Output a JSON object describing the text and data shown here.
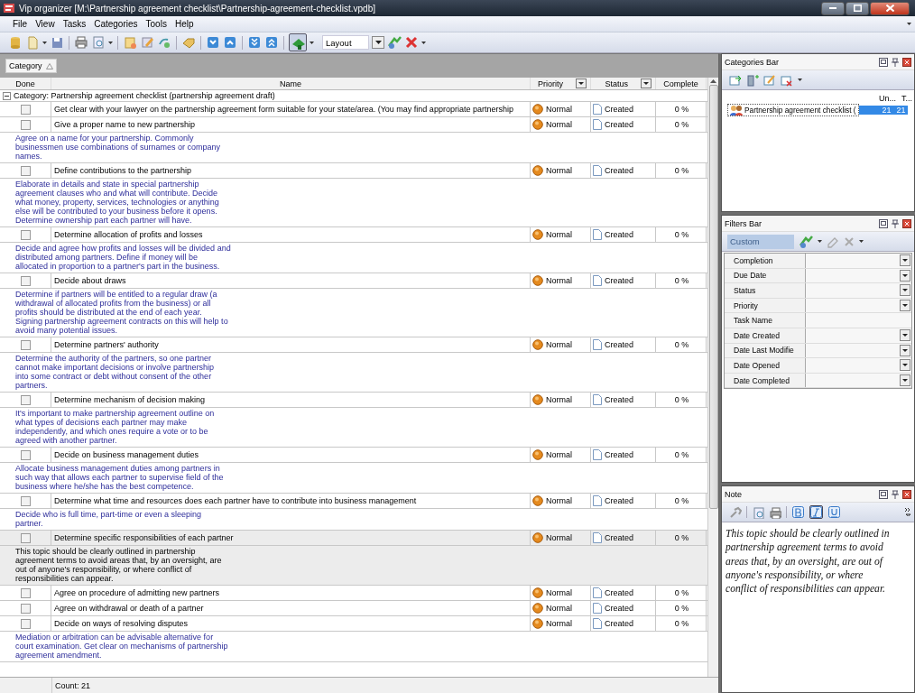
{
  "window": {
    "title": "Vip organizer [M:\\Partnership agreement checklist\\Partnership-agreement-checklist.vpdb]"
  },
  "menu": [
    {
      "label": "File"
    },
    {
      "label": "View"
    },
    {
      "label": "Tasks"
    },
    {
      "label": "Categories"
    },
    {
      "label": "Tools"
    },
    {
      "label": "Help"
    }
  ],
  "toolbar": {
    "layout_field": "Layout"
  },
  "grid": {
    "group_by": "Category",
    "columns": [
      "Done",
      "Name",
      "Priority",
      "Status",
      "Complete"
    ],
    "group": {
      "label": "Category: Partnership agreement checklist (partnership agreement draft)",
      "expanded": true
    },
    "tasks": [
      {
        "name": "Get clear with your lawyer on the partnership agreement form suitable for your state/area. (You may find appropriate partnership",
        "done": false,
        "priority": "Normal",
        "status": "Created",
        "complete": "0 %",
        "selected": false
      },
      {
        "name": "Give a proper name to new partnership",
        "done": false,
        "priority": "Normal",
        "status": "Created",
        "complete": "0 %",
        "selected": false,
        "note": "Agree on a name for your partnership. Commonly\nbusinessmen use combinations of surnames or company\nnames."
      },
      {
        "name": "Define contributions to the partnership",
        "done": false,
        "priority": "Normal",
        "status": "Created",
        "complete": "0 %",
        "selected": false,
        "note": "Elaborate in details and state in special partnership\nagreement clauses who and what will contribute. Decide\nwhat money, property, services, technologies or anything\nelse will be contributed to your business before it opens.\nDetermine ownership part each partner will have."
      },
      {
        "name": "Determine allocation of profits and losses",
        "done": false,
        "priority": "Normal",
        "status": "Created",
        "complete": "0 %",
        "selected": false,
        "note": "Decide and agree how profits and losses will be divided and\ndistributed among partners. Define if money will be\nallocated in proportion to a partner's part in the business."
      },
      {
        "name": "Decide about draws",
        "done": false,
        "priority": "Normal",
        "status": "Created",
        "complete": "0 %",
        "selected": false,
        "note": "Determine if partners will be entitled to a regular draw (a\nwithdrawal of allocated profits from the business) or all\nprofits should be distributed at the end of each year.\nSigning partnership agreement contracts on this will help to\navoid many potential issues."
      },
      {
        "name": "Determine partners' authority",
        "done": false,
        "priority": "Normal",
        "status": "Created",
        "complete": "0 %",
        "selected": false,
        "note": "Determine the authority of the partners, so one partner\ncannot make important decisions or involve partnership\ninto some contract or debt without consent of the other\npartners."
      },
      {
        "name": "Determine mechanism of decision making",
        "done": false,
        "priority": "Normal",
        "status": "Created",
        "complete": "0 %",
        "selected": false,
        "note": "It's important to make partnership agreement outline on\nwhat types of decisions each partner may make\nindependently, and which ones require a vote or to be\nagreed with another partner."
      },
      {
        "name": "Decide on business management duties",
        "done": false,
        "priority": "Normal",
        "status": "Created",
        "complete": "0 %",
        "selected": false,
        "note": "Allocate business management duties among partners in\nsuch way that allows each partner to supervise field of the\nbusiness where he/she has the best competence."
      },
      {
        "name": "Determine what time and resources does each partner have to contribute into business management",
        "done": false,
        "priority": "Normal",
        "status": "Created",
        "complete": "0 %",
        "selected": false,
        "note": "Decide who is full time, part-time or even a sleeping\npartner."
      },
      {
        "name": "Determine specific responsibilities of each partner",
        "done": false,
        "priority": "Normal",
        "status": "Created",
        "complete": "0 %",
        "selected": true,
        "note": "This topic should be clearly outlined in partnership\nagreement terms to avoid areas that, by an oversight, are\nout of anyone's responsibility, or where conflict of\nresponsibilities can appear."
      },
      {
        "name": "Agree on procedure of admitting new partners",
        "done": false,
        "priority": "Normal",
        "status": "Created",
        "complete": "0 %",
        "selected": false
      },
      {
        "name": "Agree on withdrawal or death of a partner",
        "done": false,
        "priority": "Normal",
        "status": "Created",
        "complete": "0 %",
        "selected": false
      },
      {
        "name": "Decide on ways of resolving disputes",
        "done": false,
        "priority": "Normal",
        "status": "Created",
        "complete": "0 %",
        "selected": false,
        "note": "Mediation or arbitration can be advisable alternative for\ncourt examination. Get clear on mechanisms of partnership\nagreement amendment."
      }
    ]
  },
  "status_bar": {
    "count": "Count: 21"
  },
  "categories_bar": {
    "title": "Categories Bar",
    "columns": [
      "Un...",
      "T..."
    ],
    "items": [
      {
        "name": "Partnership agreement checklist (",
        "unfinished": "21",
        "total": "21",
        "selected": true
      }
    ]
  },
  "filters_bar": {
    "title": "Filters Bar",
    "preset_placeholder": "Custom",
    "filters": [
      {
        "label": "Completion",
        "kind": "dropdown"
      },
      {
        "label": "Due Date",
        "kind": "dropdown"
      },
      {
        "label": "Status",
        "kind": "dropdown"
      },
      {
        "label": "Priority",
        "kind": "dropdown"
      },
      {
        "label": "Task Name",
        "kind": "text"
      },
      {
        "label": "Date Created",
        "kind": "dropdown"
      },
      {
        "label": "Date Last Modifie",
        "kind": "dropdown"
      },
      {
        "label": "Date Opened",
        "kind": "dropdown"
      },
      {
        "label": "Date Completed",
        "kind": "dropdown"
      }
    ]
  },
  "note_panel": {
    "title": "Note",
    "bold_on": false,
    "italic_on": true,
    "underline_on": false,
    "text": "This topic should be clearly outlined in\npartnership agreement terms to avoid\nareas that, by an oversight, are out of\nanyone's responsibility, or where\nconflict of responsibilities can appear."
  }
}
